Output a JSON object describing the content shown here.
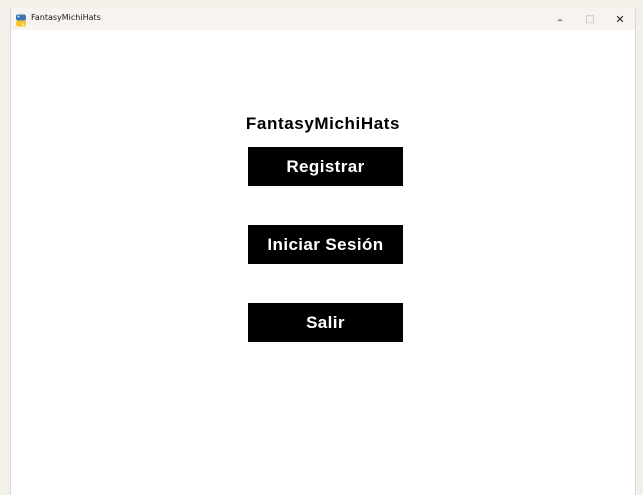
{
  "window": {
    "title": "FantasyMichiHats",
    "icon": "python-icon",
    "controls": {
      "minimize": "–",
      "maximize": "□",
      "close": "✕"
    }
  },
  "main": {
    "title": "FantasyMichiHats",
    "buttons": [
      {
        "label": "Registrar"
      },
      {
        "label": "Iniciar Sesión"
      },
      {
        "label": "Salir"
      }
    ]
  },
  "colors": {
    "button_bg": "#000000",
    "button_text": "#ffffff",
    "background": "#ffffff"
  }
}
